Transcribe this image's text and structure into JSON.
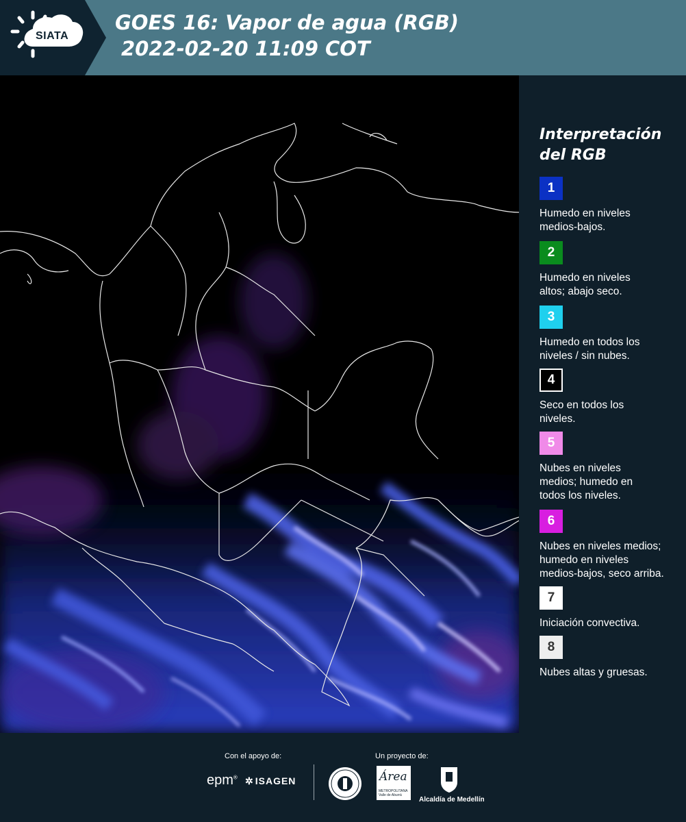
{
  "header": {
    "logo_text": "SIATA",
    "title_line1": "GOES 16: Vapor de agua (RGB)",
    "title_line2": "2022-02-20 11:09 COT"
  },
  "legend": {
    "title_line1": "Interpretación",
    "title_line2": "del RGB",
    "items": [
      {
        "num": "1",
        "color": "#0b31c4",
        "line1": "Humedo en niveles",
        "line2": "medios-bajos.",
        "line3": ""
      },
      {
        "num": "2",
        "color": "#0a8c1e",
        "line1": "Humedo en niveles",
        "line2": "altos; abajo seco.",
        "line3": ""
      },
      {
        "num": "3",
        "color": "#1fd0ee",
        "line1": "Humedo en todos los",
        "line2": "niveles / sin nubes.",
        "line3": ""
      },
      {
        "num": "4",
        "color": "#000000",
        "line1": "Seco en todos los",
        "line2": "niveles.",
        "line3": ""
      },
      {
        "num": "5",
        "color": "#f08ae8",
        "line1": "Nubes en niveles",
        "line2": "medios; humedo en",
        "line3": "todos los niveles."
      },
      {
        "num": "6",
        "color": "#d81ee0",
        "line1": "Nubes en niveles medios;",
        "line2": "humedo en niveles",
        "line3": "medios-bajos, seco arriba."
      },
      {
        "num": "7",
        "color": "#ffffff",
        "line1": "Iniciación convectiva.",
        "line2": "",
        "line3": ""
      },
      {
        "num": "8",
        "color": "#eeeeee",
        "line1": "Nubes altas y gruesas.",
        "line2": "",
        "line3": ""
      }
    ]
  },
  "footer": {
    "support_label": "Con el apoyo de:",
    "project_label": "Un proyecto de:",
    "epm": "epm",
    "isagen": "ISAGEN",
    "area_word": "Área",
    "area_sub": "METROPOLITANA Valle de Aburrá",
    "alcaldia": "Alcaldía de Medellín"
  }
}
